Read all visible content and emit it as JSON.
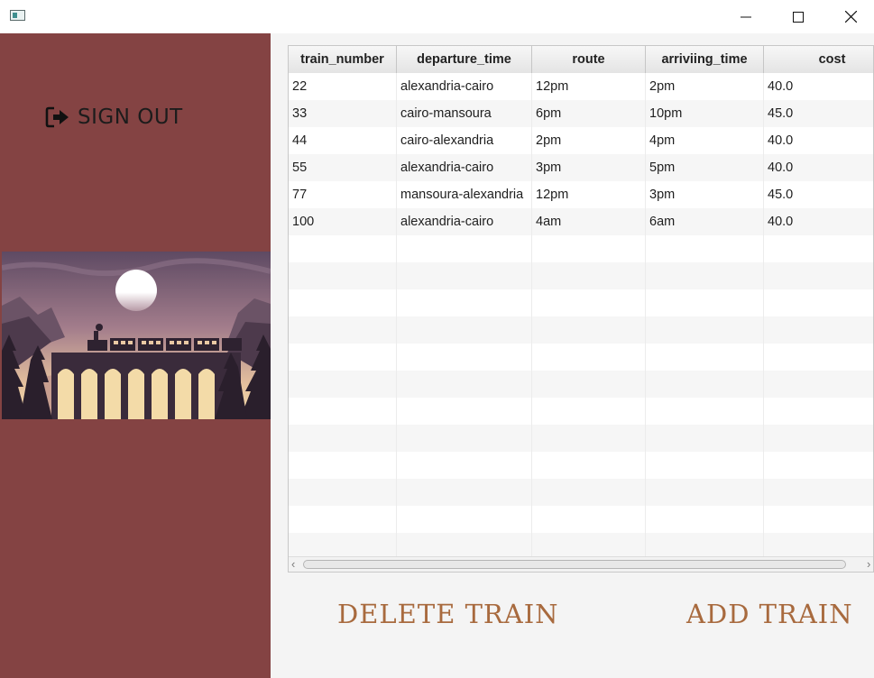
{
  "window": {
    "minimize_icon": "minimize-icon",
    "maximize_icon": "maximize-icon",
    "close_icon": "close-icon"
  },
  "sidebar": {
    "signout_label": "SIGN OUT",
    "signout_icon": "sign-out-icon",
    "illustration": "train-on-viaduct-at-sunset",
    "bg_color": "#844343"
  },
  "table": {
    "columns": [
      "train_number",
      "departure_time",
      "route",
      "arriviing_time",
      "cost"
    ],
    "rows": [
      [
        "22",
        "alexandria-cairo",
        "12pm",
        "2pm",
        "40.0"
      ],
      [
        "33",
        "cairo-mansoura",
        "6pm",
        "10pm",
        "45.0"
      ],
      [
        "44",
        "cairo-alexandria",
        "2pm",
        "4pm",
        "40.0"
      ],
      [
        "55",
        "alexandria-cairo",
        "3pm",
        "5pm",
        "40.0"
      ],
      [
        "77",
        "mansoura-alexandria",
        "12pm",
        "3pm",
        "45.0"
      ],
      [
        "100",
        "alexandria-cairo",
        "4am",
        "6am",
        "40.0"
      ]
    ]
  },
  "actions": {
    "delete_label": "DELETE TRAIN",
    "add_label": "ADD TRAIN",
    "accent_color": "#a86a3e"
  }
}
